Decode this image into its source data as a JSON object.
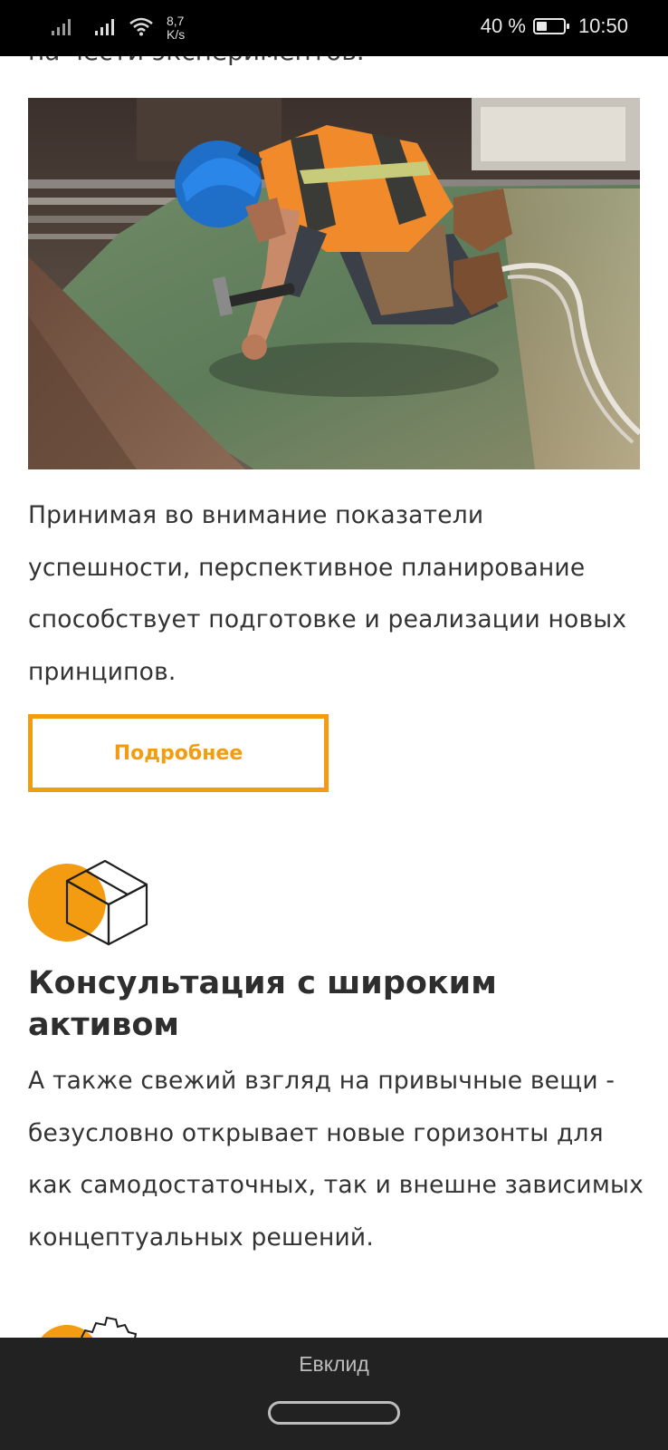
{
  "status_bar": {
    "network_speed_value": "8,7",
    "network_speed_unit": "K/s",
    "battery_percent": "40 %",
    "battery_level": 0.4,
    "time": "10:50",
    "icons": [
      "signal-icon",
      "signal-icon",
      "wifi-icon",
      "battery-icon"
    ]
  },
  "content": {
    "cut_off_text": "на чести экспериментов.",
    "hero_image_alt": "Строитель в каске работает молотком на крыше",
    "paragraph_1": "Принимая во внимание показатели успешности, перспективное планирование способствует подготовке и реализации новых принципов.",
    "more_button_label": "Подробнее",
    "feature": {
      "icon": "box-icon",
      "title": "Консультация с широким активом",
      "text": "А также свежий взгляд на привычные вещи - безусловно открывает новые горизонты для как самодостаточных, так и внешне зависимых концептуальных решений."
    },
    "next_feature_icon": "gear-icon"
  },
  "bottom_bar": {
    "title": "Евклид"
  },
  "colors": {
    "accent": "#f39c12",
    "text": "#333333",
    "status_bar_bg": "#000000",
    "bottom_bar_bg": "#222222"
  }
}
